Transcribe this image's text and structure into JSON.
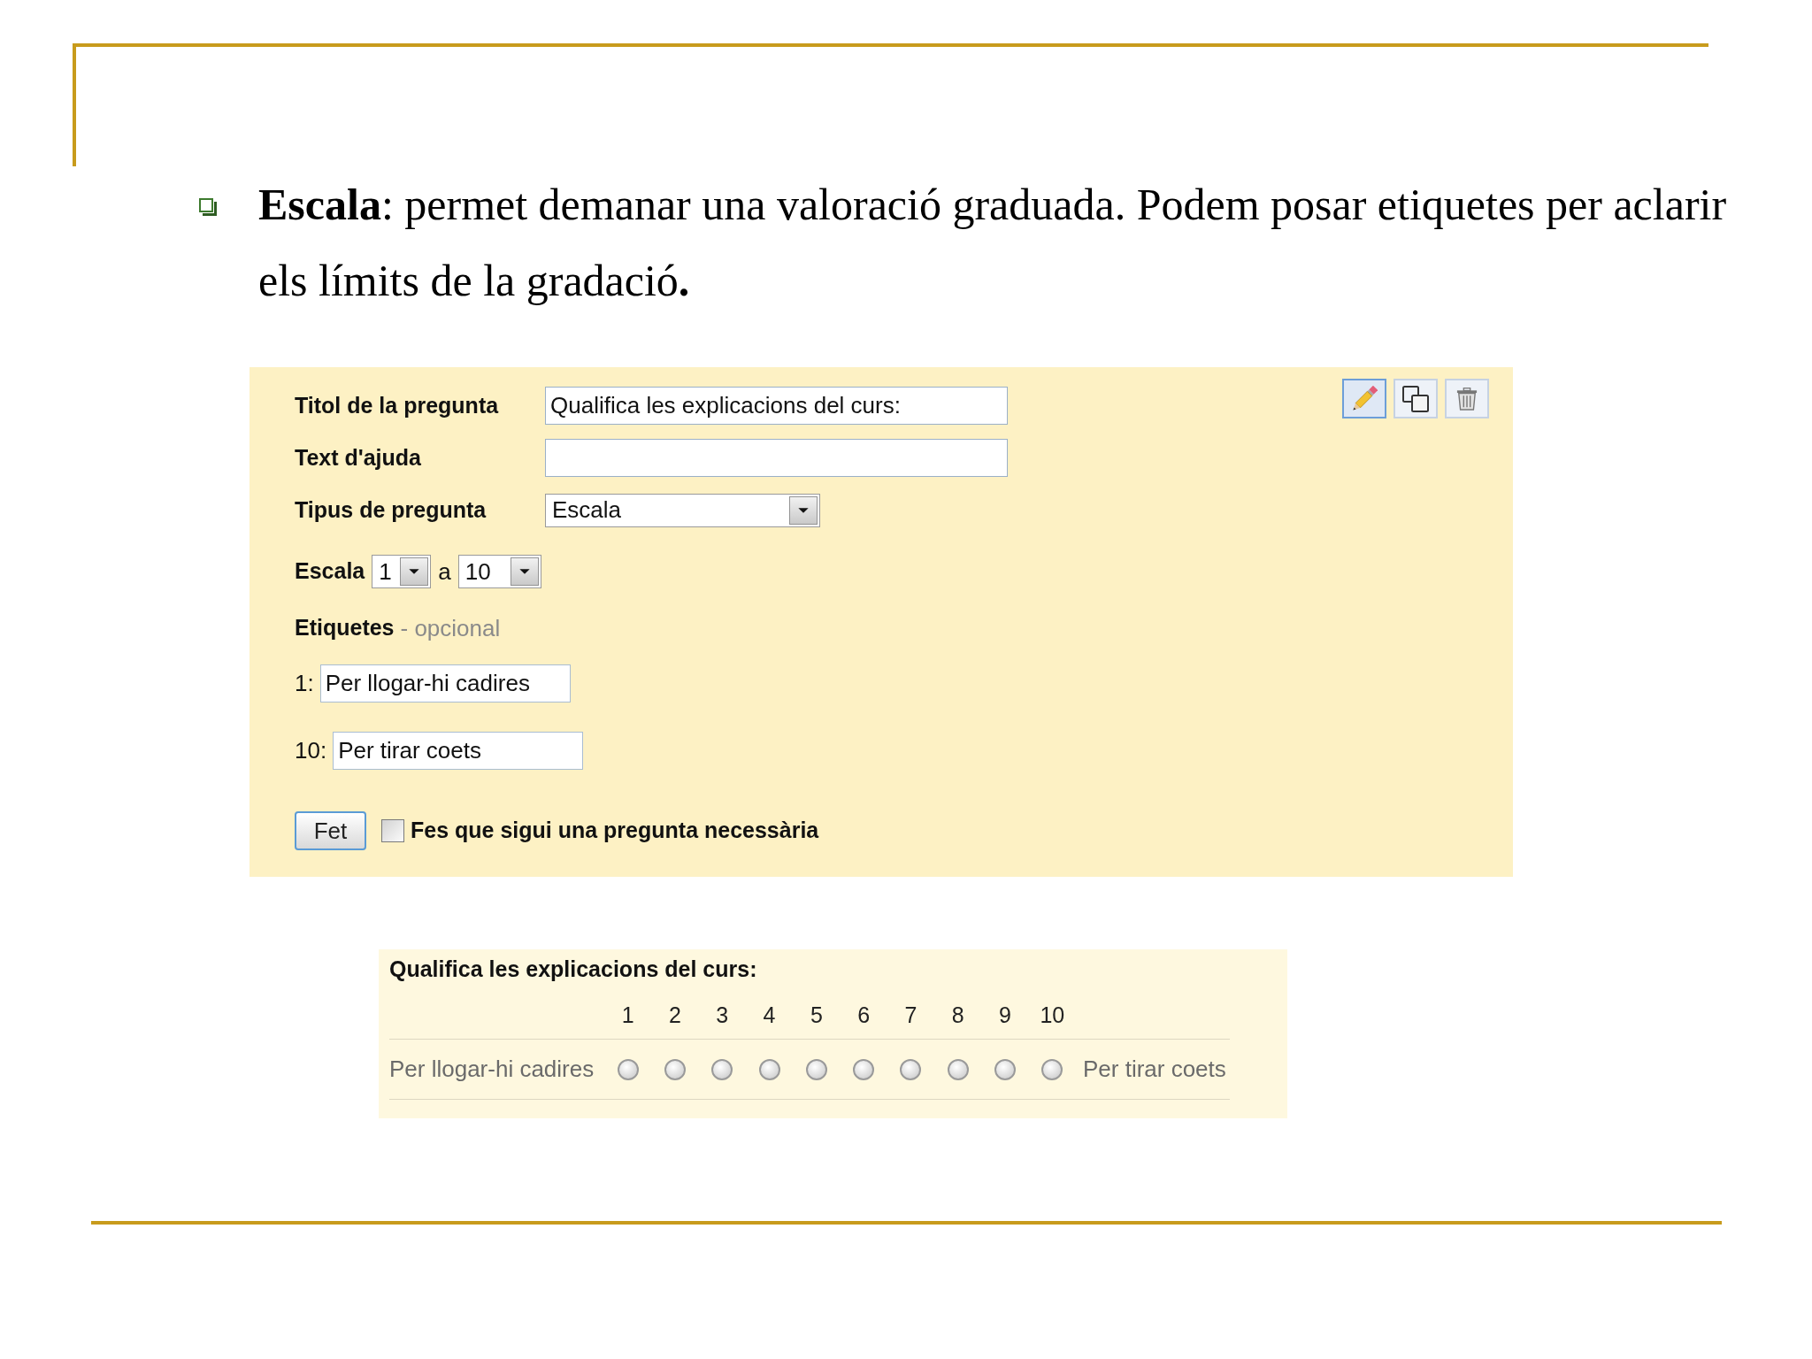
{
  "slide": {
    "bullet": "**Escala**: permet demanar una valoració graduada. Podem posar etiquetes per aclarir els límits de la gradació**.**"
  },
  "editor": {
    "tools": [
      {
        "kind": "edit",
        "selected": true
      },
      {
        "kind": "duplicate",
        "selected": false
      },
      {
        "kind": "delete",
        "selected": false
      }
    ],
    "fields": [
      {
        "kind": "text",
        "label": "Titol de la pregunta",
        "value": "Qualifica les explicacions del curs:"
      },
      {
        "kind": "text",
        "label": "Text d'ajuda"
      },
      {
        "kind": "select",
        "label": "Tipus de pregunta",
        "value": "Escala"
      }
    ],
    "scale": {
      "label": "Escala",
      "from": "1",
      "separator": "a",
      "to": "10"
    },
    "labels": {
      "title": "Etiquetes",
      "note": "- opcional",
      "items": [
        {
          "key": "1:",
          "value": "Per llogar-hi cadires"
        },
        {
          "key": "10:",
          "value": "Per tirar coets"
        }
      ]
    },
    "done_button": "Fet",
    "required": {
      "label": "Fes que sigui una pregunta necessària",
      "checked": false
    }
  },
  "preview": {
    "title": "Qualifica les explicacions del curs:",
    "low_label": "Per llogar-hi cadires",
    "high_label": "Per tirar coets",
    "options": [
      {
        "label": "1",
        "selected": false
      },
      {
        "label": "2",
        "selected": false
      },
      {
        "label": "3",
        "selected": false
      },
      {
        "label": "4",
        "selected": false
      },
      {
        "label": "5",
        "selected": false
      },
      {
        "label": "6",
        "selected": false
      },
      {
        "label": "7",
        "selected": false
      },
      {
        "label": "8",
        "selected": false
      },
      {
        "label": "9",
        "selected": false
      },
      {
        "label": "10",
        "selected": false
      }
    ]
  }
}
